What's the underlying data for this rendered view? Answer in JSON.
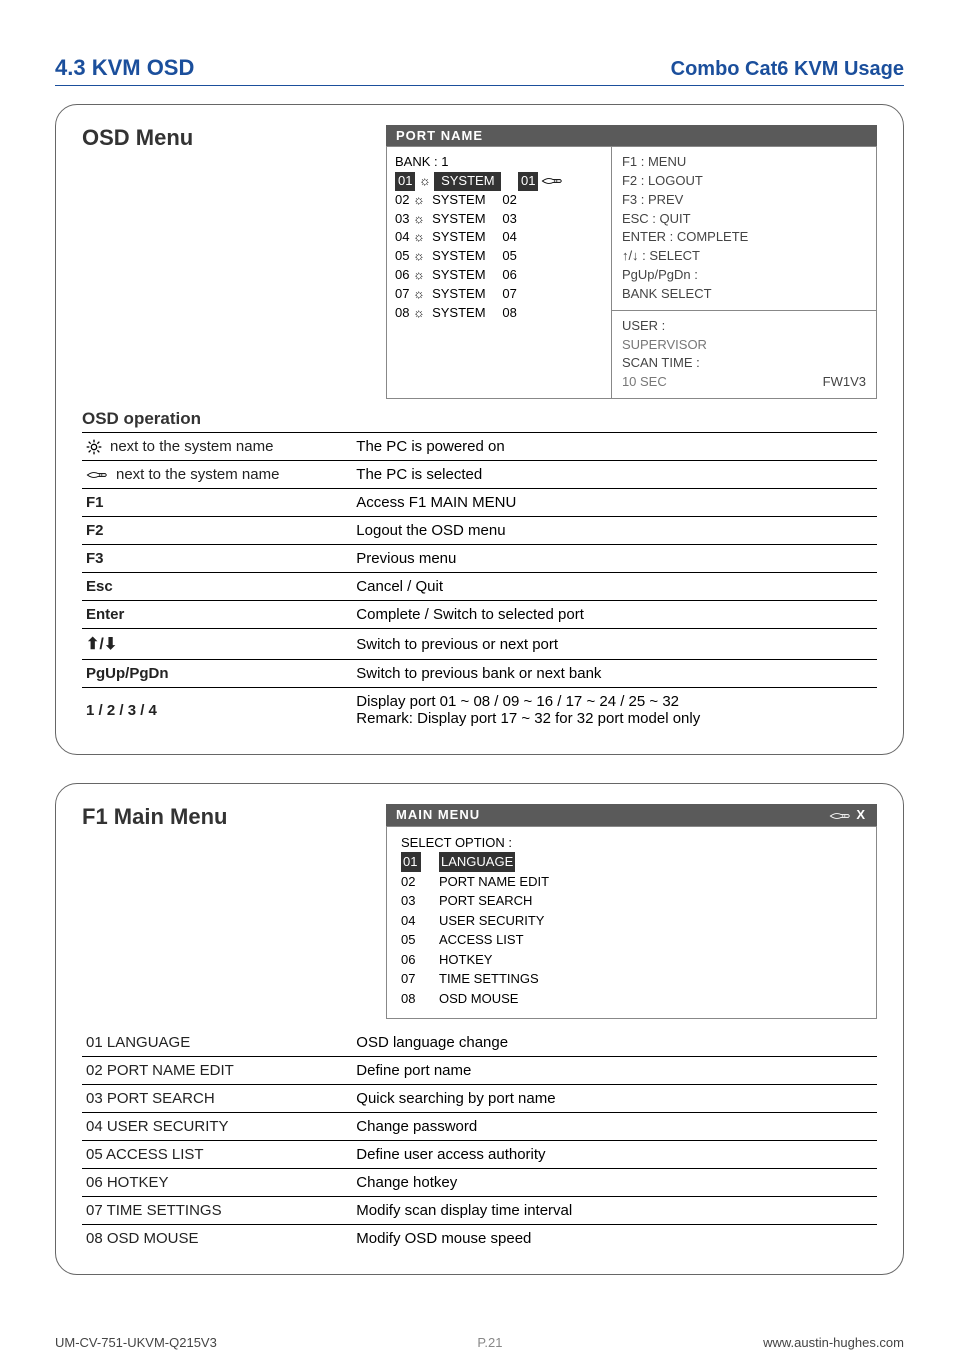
{
  "header": {
    "left": "4.3   KVM OSD",
    "right": "Combo  Cat6 KVM Usage"
  },
  "section1": {
    "title": "OSD Menu",
    "subheading": "OSD operation",
    "osd": {
      "headerTitle": "PORT  NAME",
      "bankLine": "BANK : 1",
      "ports": [
        {
          "idx": "01",
          "name": "SYSTEM",
          "num": "01",
          "selected": true
        },
        {
          "idx": "02",
          "name": "SYSTEM",
          "num": "02",
          "selected": false
        },
        {
          "idx": "03",
          "name": "SYSTEM",
          "num": "03",
          "selected": false
        },
        {
          "idx": "04",
          "name": "SYSTEM",
          "num": "04",
          "selected": false
        },
        {
          "idx": "05",
          "name": "SYSTEM",
          "num": "05",
          "selected": false
        },
        {
          "idx": "06",
          "name": "SYSTEM",
          "num": "06",
          "selected": false
        },
        {
          "idx": "07",
          "name": "SYSTEM",
          "num": "07",
          "selected": false
        },
        {
          "idx": "08",
          "name": "SYSTEM",
          "num": "08",
          "selected": false
        }
      ],
      "hints": [
        "F1 : MENU",
        "F2 : LOGOUT",
        "F3 : PREV",
        "ESC : QUIT",
        "ENTER : COMPLETE",
        "↑/↓ : SELECT",
        "PgUp/PgDn :",
        "BANK SELECT"
      ],
      "userLabel": "USER :",
      "userValue": "SUPERVISOR",
      "scanLabel": "SCAN TIME :",
      "scanValue": "10 SEC",
      "fw": "FW1V3"
    },
    "ops": [
      {
        "key_icon": "sun",
        "key_text": "next to the system name",
        "desc": "The PC is powered on"
      },
      {
        "key_icon": "hand",
        "key_text": "next to the system name",
        "desc": "The PC is selected"
      },
      {
        "key_icon": "",
        "key_text": "F1",
        "desc": "Access F1 MAIN MENU"
      },
      {
        "key_icon": "",
        "key_text": "F2",
        "desc": "Logout the OSD menu"
      },
      {
        "key_icon": "",
        "key_text": "F3",
        "desc": "Previous menu"
      },
      {
        "key_icon": "",
        "key_text": "Esc",
        "desc": "Cancel / Quit"
      },
      {
        "key_icon": "",
        "key_text": "Enter",
        "desc": "Complete / Switch to selected port"
      },
      {
        "key_icon": "",
        "key_text": "↑/↓",
        "desc": "Switch to previous or next port"
      },
      {
        "key_icon": "",
        "key_text": "PgUp/PgDn",
        "desc": "Switch to previous bank or next bank"
      },
      {
        "key_icon": "",
        "key_text": "1 / 2 / 3 / 4",
        "desc": "Display port  01 ~ 08 / 09 ~ 16 / 17 ~ 24 / 25 ~ 32\nRemark:  Display port 17 ~ 32 for 32 port model only"
      }
    ]
  },
  "section2": {
    "title": "F1 Main Menu",
    "osd": {
      "headerTitle": "MAIN  MENU",
      "selectLabel": "SELECT OPTION :",
      "items": [
        {
          "idx": "01",
          "name": "LANGUAGE",
          "selected": true
        },
        {
          "idx": "02",
          "name": "PORT NAME  EDIT",
          "selected": false
        },
        {
          "idx": "03",
          "name": "PORT SEARCH",
          "selected": false
        },
        {
          "idx": "04",
          "name": "USER SECURITY",
          "selected": false
        },
        {
          "idx": "05",
          "name": "ACCESS LIST",
          "selected": false
        },
        {
          "idx": "06",
          "name": "HOTKEY",
          "selected": false
        },
        {
          "idx": "07",
          "name": "TIME SETTINGS",
          "selected": false
        },
        {
          "idx": "08",
          "name": "OSD MOUSE",
          "selected": false
        }
      ]
    },
    "ops": [
      {
        "key_text": "01  LANGUAGE",
        "desc": "OSD language change"
      },
      {
        "key_text": "02  PORT NAME EDIT",
        "desc": "Define port name"
      },
      {
        "key_text": "03  PORT SEARCH",
        "desc": "Quick searching by port name"
      },
      {
        "key_text": "04  USER SECURITY",
        "desc": "Change password"
      },
      {
        "key_text": "05  ACCESS LIST",
        "desc": "Define user access authority"
      },
      {
        "key_text": "06  HOTKEY",
        "desc": "Change hotkey"
      },
      {
        "key_text": "07  TIME SETTINGS",
        "desc": "Modify scan display time interval"
      },
      {
        "key_text": "08  OSD MOUSE",
        "desc": "Modify OSD mouse speed"
      }
    ]
  },
  "footer": {
    "left": "UM-CV-751-UKVM-Q215V3",
    "mid": "P.21",
    "right": "www.austin-hughes.com"
  }
}
